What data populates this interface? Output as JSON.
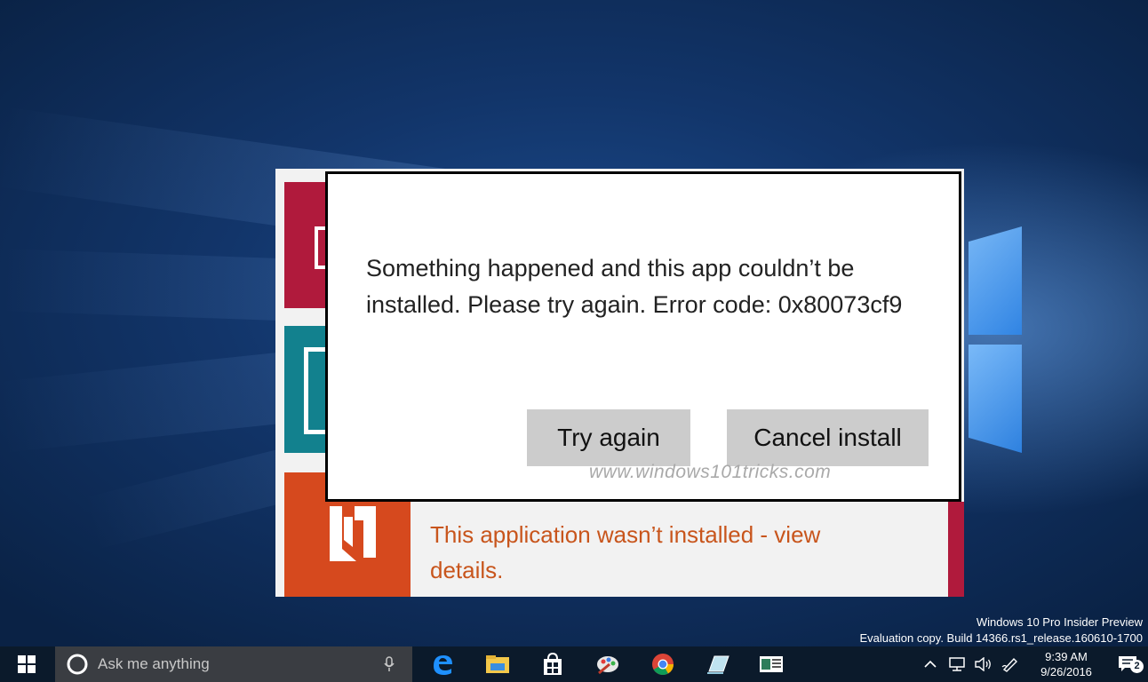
{
  "dialog": {
    "message": "Something happened and this app couldn’t be installed. Please try again. Error code: 0x80073cf9",
    "try_again_label": "Try again",
    "cancel_install_label": "Cancel install"
  },
  "notification": {
    "text": "This application wasn’t installed - view details."
  },
  "watermark": "www.windows101tricks.com",
  "desktop": {
    "eval_line1": "Windows 10 Pro Insider Preview",
    "eval_line2": "Evaluation copy. Build 14366.rs1_release.160610-1700"
  },
  "taskbar": {
    "search_placeholder": "Ask me anything",
    "apps": [
      "edge-icon",
      "file-explorer-icon",
      "store-icon",
      "paint-icon",
      "chrome-icon",
      "app-icon",
      "monitor-app-icon"
    ],
    "clock_time": "9:39 AM",
    "clock_date": "9/26/2016",
    "notification_count": "2"
  },
  "colors": {
    "accent_blue": "#1c4c8e",
    "tile_red": "#b01a3c",
    "tile_teal": "#12818e",
    "tile_orange": "#d6491e",
    "notification_text": "#c8551c"
  }
}
